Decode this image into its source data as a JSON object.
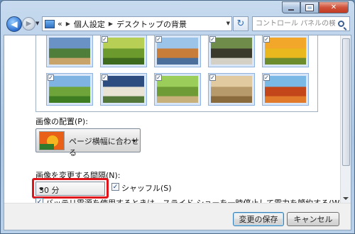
{
  "window": {
    "minimize_label": "",
    "maximize_label": "",
    "close_label": "✕"
  },
  "navbar": {
    "back_icon": "◀",
    "forward_icon": "▶",
    "breadcrumb_prefix": "«",
    "breadcrumbs": [
      "個人設定",
      "デスクトップの背景"
    ],
    "search_placeholder": "コントロール パネルの検索"
  },
  "gallery": {
    "thumbnails": [
      {
        "checked": true,
        "selected": true,
        "colors": [
          "#6a92c4",
          "#4f7d3a",
          "#c8a46a"
        ]
      },
      {
        "checked": true,
        "selected": true,
        "colors": [
          "#b7cf55",
          "#6c9a2c",
          "#3e6b1d"
        ]
      },
      {
        "checked": true,
        "selected": true,
        "colors": [
          "#9cc3e8",
          "#c87d3a",
          "#4b6f9a"
        ]
      },
      {
        "checked": true,
        "selected": true,
        "colors": [
          "#6f8c4a",
          "#3a3a2c",
          "#d4d0c6"
        ]
      },
      {
        "checked": true,
        "selected": true,
        "colors": [
          "#f2a62a",
          "#e9b81e",
          "#6d8c2d"
        ]
      },
      {
        "checked": true,
        "selected": true,
        "colors": [
          "#7fb4e2",
          "#6ea43a",
          "#3f7d22"
        ]
      },
      {
        "checked": true,
        "selected": true,
        "colors": [
          "#2d4c7f",
          "#e9e3d6",
          "#54783a"
        ]
      },
      {
        "checked": true,
        "selected": true,
        "colors": [
          "#9acd5a",
          "#6e9b36",
          "#c7b07a"
        ]
      },
      {
        "checked": true,
        "selected": true,
        "colors": [
          "#e1c9a0",
          "#b79a6c",
          "#8a6b3d"
        ]
      },
      {
        "checked": true,
        "selected": true,
        "colors": [
          "#7ab8e6",
          "#c2461a",
          "#e27a2c"
        ]
      }
    ]
  },
  "position": {
    "label": "画像の配置(P):",
    "value": "ページ横幅に合わせる"
  },
  "interval": {
    "label": "画像を変更する間隔(N):",
    "value": "30 分"
  },
  "shuffle": {
    "checked": true,
    "label": "シャッフル(S)"
  },
  "battery": {
    "checked": true,
    "label": "バッテリ電源を使用するときは、スライド ショーを一時停止して電力を節約する(W)"
  },
  "footer": {
    "save_label": "変更の保存",
    "cancel_label": "キャンセル"
  },
  "colors": {
    "highlight": "#e0141b",
    "selection": "#d8e6f7"
  }
}
